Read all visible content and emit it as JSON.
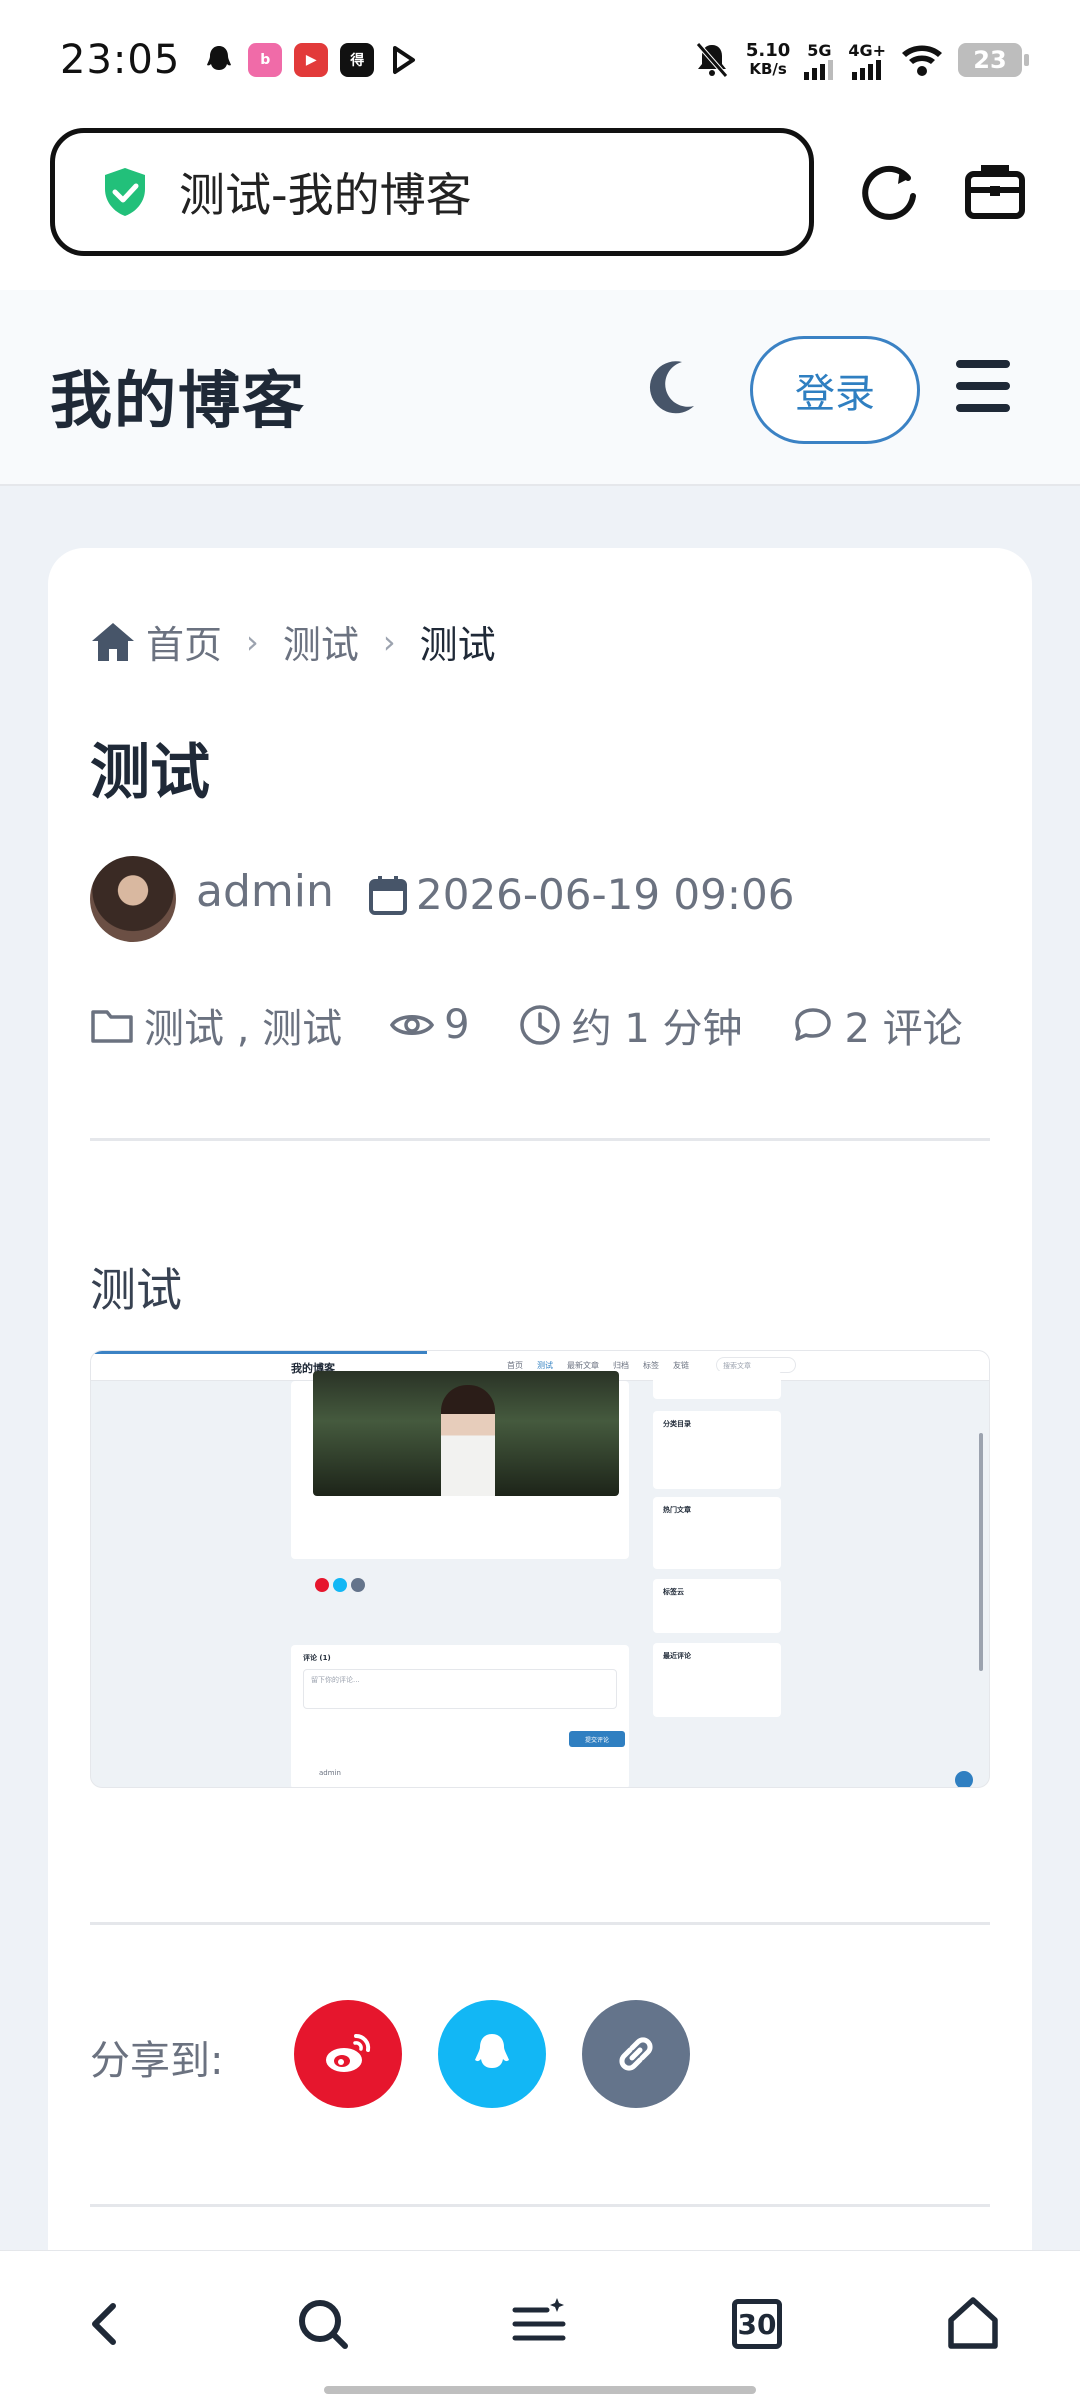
{
  "status_bar": {
    "time": "23:05",
    "net_speed_value": "5.10",
    "net_speed_unit": "KB/s",
    "signal_1": "5G",
    "signal_2": "4G+",
    "battery": "23",
    "app_icons": [
      "qq-icon",
      "bilibili-icon",
      "video-app-icon",
      "dewu-icon",
      "play-icon"
    ]
  },
  "browser": {
    "url_title": "测试-我的博客",
    "reload_icon": "reload-icon",
    "toolbox_icon": "toolbox-icon",
    "secure_color": "#22c07a"
  },
  "site": {
    "brand": "我的博客",
    "login_label": "登录",
    "accent": "#2f7fc1"
  },
  "post": {
    "breadcrumb": [
      "首页",
      "测试",
      "测试"
    ],
    "title": "测试",
    "author": "admin",
    "date": "2026-06-19 09:06",
    "categories": "测试 , 测试",
    "views": "9",
    "read_time": "约 1 分钟",
    "comments": "2 评论",
    "body_text": "测试"
  },
  "embedded_screenshot": {
    "brand": "我的博客",
    "nav": [
      "首页",
      "测试",
      "最新文章",
      "归档",
      "标签",
      "友链"
    ],
    "search_placeholder": "搜索文章",
    "sidebar_titles": [
      "分类目录",
      "热门文章",
      "标签云",
      "最近评论"
    ],
    "comments_title": "评论 (1)",
    "comment_placeholder": "留下你的评论...",
    "submit": "提交评论",
    "author": "admin"
  },
  "share": {
    "label": "分享到:",
    "buttons": [
      {
        "name": "weibo",
        "color": "#e6162d"
      },
      {
        "name": "qq",
        "color": "#12b7f5"
      },
      {
        "name": "link",
        "color": "#64748b"
      }
    ]
  },
  "bottom_nav": {
    "tab_count": "30"
  }
}
